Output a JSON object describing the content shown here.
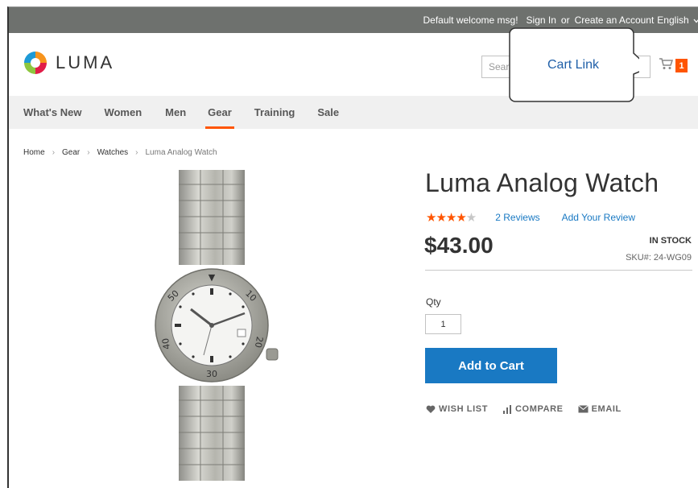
{
  "topbar": {
    "welcome": "Default welcome msg!",
    "sign_in": "Sign In",
    "or": "or",
    "create_account": "Create an Account",
    "language": "English"
  },
  "header": {
    "logo_text": "LUMA",
    "search_placeholder": "Sear",
    "cart_count": "1"
  },
  "nav": {
    "items": [
      "What's New",
      "Women",
      "Men",
      "Gear",
      "Training",
      "Sale"
    ],
    "active": "Gear"
  },
  "breadcrumb": [
    "Home",
    "Gear",
    "Watches",
    "Luma Analog Watch"
  ],
  "product": {
    "title": "Luma Analog Watch",
    "rating_stars": 4,
    "rating_max": 5,
    "reviews": "2 Reviews",
    "add_review": "Add Your Review",
    "price": "$43.00",
    "stock": "IN STOCK",
    "sku": "SKU#:  24-WG09",
    "qty_label": "Qty",
    "qty_value": "1",
    "add_to_cart": "Add to Cart",
    "actions": [
      "WISH LIST",
      "COMPARE",
      "EMAIL"
    ]
  },
  "callout": {
    "text": "Cart Link"
  },
  "colors": {
    "accent": "#ff5501",
    "primary_button": "#1979c3",
    "link": "#1979c3",
    "topbar": "#6e716e"
  }
}
